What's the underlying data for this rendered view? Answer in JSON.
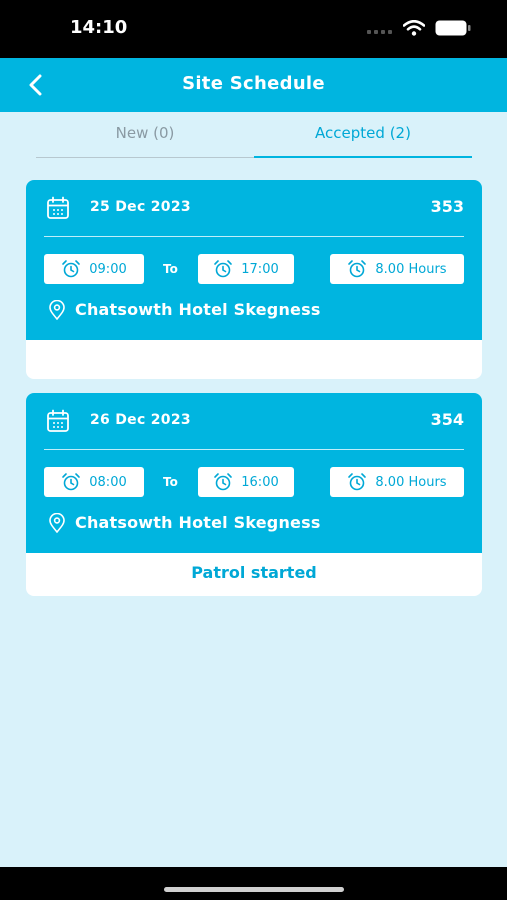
{
  "status_bar": {
    "time": "14:10"
  },
  "header": {
    "title": "Site Schedule"
  },
  "tabs": [
    {
      "label": "New (0)",
      "active": false
    },
    {
      "label": "Accepted (2)",
      "active": true
    }
  ],
  "schedules": [
    {
      "date": "25 Dec 2023",
      "number": "353",
      "start_time": "09:00",
      "to_label": "To",
      "end_time": "17:00",
      "duration": "8.00 Hours",
      "location": "Chatsowth Hotel Skegness",
      "footer_text": ""
    },
    {
      "date": "26 Dec 2023",
      "number": "354",
      "start_time": "08:00",
      "to_label": "To",
      "end_time": "16:00",
      "duration": "8.00 Hours",
      "location": "Chatsowth Hotel Skegness",
      "footer_text": "Patrol started"
    }
  ],
  "colors": {
    "primary": "#00b5e0",
    "background": "#d9f2fa",
    "accent_text": "#00a8d6"
  }
}
